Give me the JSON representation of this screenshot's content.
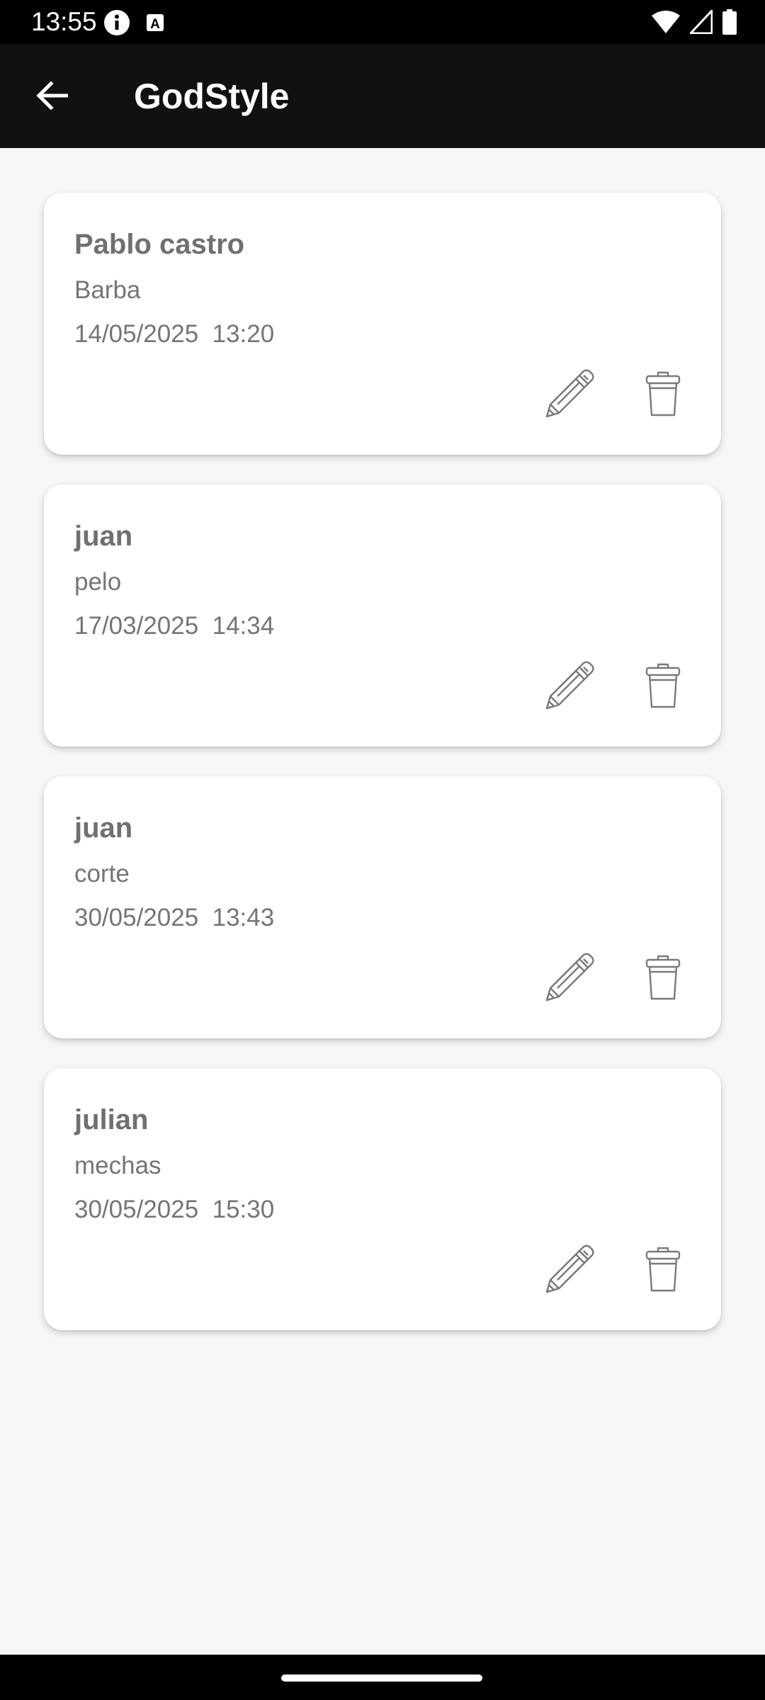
{
  "status_bar": {
    "time": "13:55",
    "icons": [
      "info-icon",
      "a-badge-icon",
      "wifi-icon",
      "cellular-signal-icon",
      "battery-icon"
    ]
  },
  "app_bar": {
    "title": "GodStyle",
    "back_icon": "arrow-left-icon"
  },
  "appointments": [
    {
      "name": "Pablo castro",
      "service": "Barba",
      "datetime": "14/05/2025  13:20"
    },
    {
      "name": "juan",
      "service": "pelo",
      "datetime": "17/03/2025  14:34"
    },
    {
      "name": "juan",
      "service": "corte",
      "datetime": "30/05/2025  13:43"
    },
    {
      "name": "julian",
      "service": "mechas",
      "datetime": "30/05/2025  15:30"
    }
  ],
  "card_actions": {
    "edit_icon": "pencil-icon",
    "delete_icon": "trash-can-icon"
  },
  "colors": {
    "app_bar": "#111111",
    "background": "#f7f7f7",
    "card": "#ffffff",
    "text_secondary": "#757575"
  }
}
